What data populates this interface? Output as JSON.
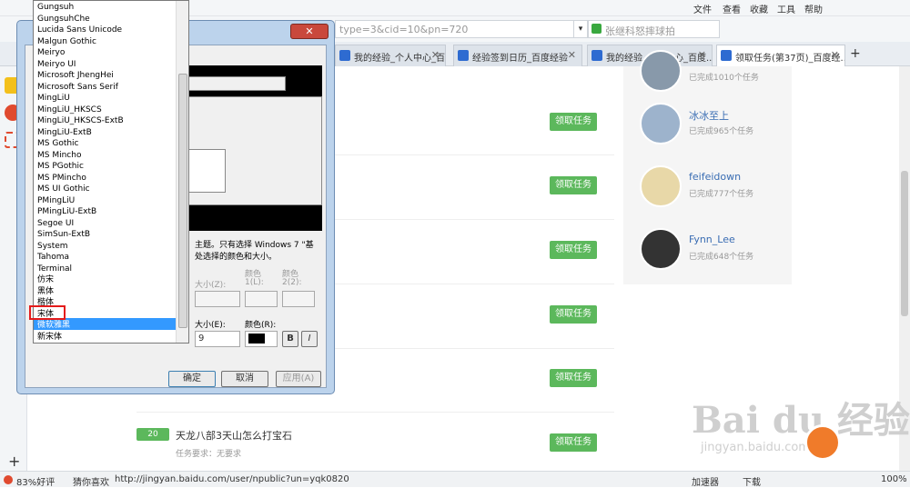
{
  "topbar": {
    "menus": [
      "文件",
      "查看",
      "收藏",
      "工具",
      "帮助"
    ]
  },
  "address": {
    "url": "type=3&cid=10&pn=720",
    "search_placeholder": "张继科怒摔球拍"
  },
  "tabs": [
    {
      "label": "我的经验_个人中心_百度..."
    },
    {
      "label": "经验签到日历_百度经验"
    },
    {
      "label": "我的经验_个人中心_百度..."
    },
    {
      "label": "领取任务(第37页)_百度经..."
    }
  ],
  "tasks": {
    "button_label": "领取任务",
    "last_title": "天龙八部3天山怎么打宝石",
    "last_badge": "20",
    "last_req": "任务要求：无要求"
  },
  "users": [
    {
      "name": "",
      "sub": "已完成1010个任务"
    },
    {
      "name": "冰冰至上",
      "sub": "已完成965个任务"
    },
    {
      "name": "feifeidown",
      "sub": "已完成777个任务"
    },
    {
      "name": "Fynn_Lee",
      "sub": "已完成648个任务"
    }
  ],
  "dialog": {
    "desc1": "主题。只有选择 Windows 7 \"基",
    "desc2": "处选择的颜色和大小。",
    "size1": "大小(Z):",
    "color1": "颜色",
    "color1b": "1(L):",
    "color2": "颜色",
    "color2b": "2(2):",
    "size_label": "大小(E):",
    "color_label": "颜色(R):",
    "size_value": "9",
    "ok": "确定",
    "cancel": "取消",
    "apply": "应用(A)",
    "bold": "B",
    "italic": "I"
  },
  "fonts": [
    "Gungsuh",
    "GungsuhChe",
    "Lucida Sans Unicode",
    "Malgun Gothic",
    "Meiryo",
    "Meiryo UI",
    "Microsoft JhengHei",
    "Microsoft Sans Serif",
    "MingLiU",
    "MingLiU_HKSCS",
    "MingLiU_HKSCS-ExtB",
    "MingLiU-ExtB",
    "MS Gothic",
    "MS Mincho",
    "MS PGothic",
    "MS PMincho",
    "MS UI Gothic",
    "PMingLiU",
    "PMingLiU-ExtB",
    "Segoe UI",
    "SimSun-ExtB",
    "System",
    "Tahoma",
    "Terminal",
    "仿宋",
    "黑体",
    "楷体",
    "宋体",
    "微软雅黑",
    "新宋体"
  ],
  "status": {
    "rating": "83%好评",
    "guess": "猜你喜欢",
    "link": "http://jingyan.baidu.com/user/npublic?un=yqk0820",
    "accel": "加速器",
    "download": "下载",
    "zoom": "100%"
  },
  "watermark": {
    "main": "Bai du 经验",
    "sub": "jingyan.baidu.com"
  },
  "colors": {
    "green": "#5cb85c",
    "selection": "#3399ff",
    "highlight": "#e41b1b"
  }
}
